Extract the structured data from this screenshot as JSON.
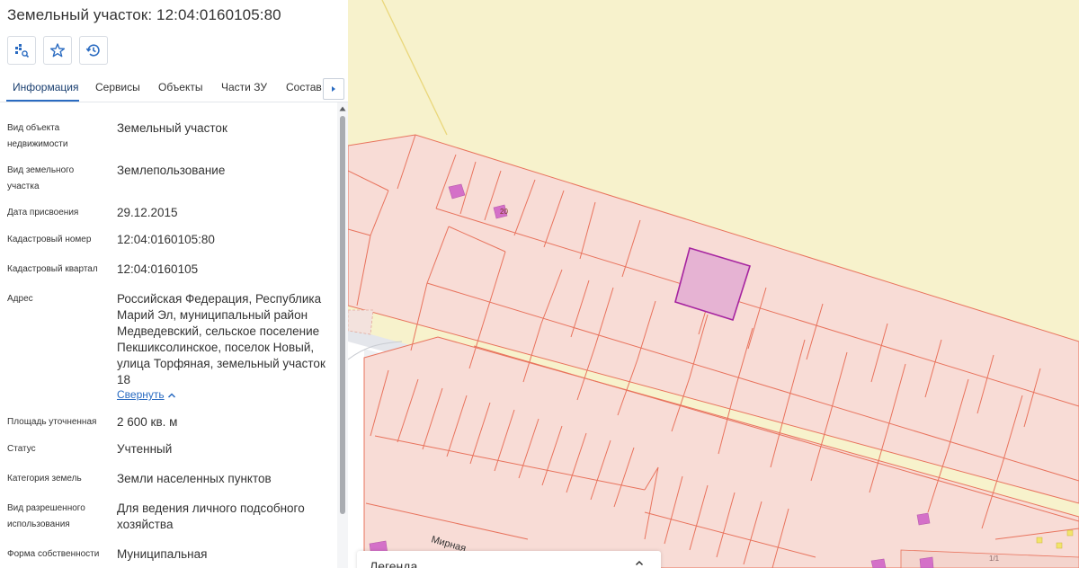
{
  "panel": {
    "title": "Земельный участок: 12:04:0160105:80",
    "tabs": [
      "Информация",
      "Сервисы",
      "Объекты",
      "Части ЗУ",
      "Состав"
    ],
    "rows": [
      {
        "label": "Вид объекта недвижимости",
        "value": "Земельный участок"
      },
      {
        "label": "Вид земельного участка",
        "value": "Землепользование"
      },
      {
        "label": "Дата присвоения",
        "value": "29.12.2015"
      },
      {
        "label": "Кадастровый номер",
        "value": "12:04:0160105:80"
      },
      {
        "label": "Кадастровый квартал",
        "value": "12:04:0160105"
      },
      {
        "label": "Адрес",
        "value": "Российская Федерация, Республика Марий Эл, муниципальный район Медведевский, сельское поселение Пекшиксолинское, поселок Новый, улица Торфяная, земельный участок 18"
      },
      {
        "label": "Площадь уточненная",
        "value": "2 600 кв. м"
      },
      {
        "label": "Статус",
        "value": "Учтенный"
      },
      {
        "label": "Категория земель",
        "value": "Земли населенных пунктов"
      },
      {
        "label": "Вид разрешенного использования",
        "value": "Для ведения личного подсобного хозяйства"
      },
      {
        "label": "Форма собственности",
        "value": "Муниципальная"
      }
    ],
    "collapse_label": "Свернуть"
  },
  "map": {
    "street_label": "Мирная",
    "parcel_numbers": {
      "building_a": "20",
      "building_b": "1/1"
    },
    "legend_title": "Легенда",
    "colors": {
      "background": "#f7f2cc",
      "parcel_fill": "#f8dcd6",
      "parcel_stroke": "#e8735d",
      "selected_fill": "#e6b3d3",
      "selected_stroke": "#a624a0",
      "building": "#d470c8",
      "road": "#ffffff"
    }
  },
  "icons": [
    "object-search-icon",
    "star-icon",
    "history-icon",
    "chevron-right-icon",
    "chevron-up-icon"
  ]
}
